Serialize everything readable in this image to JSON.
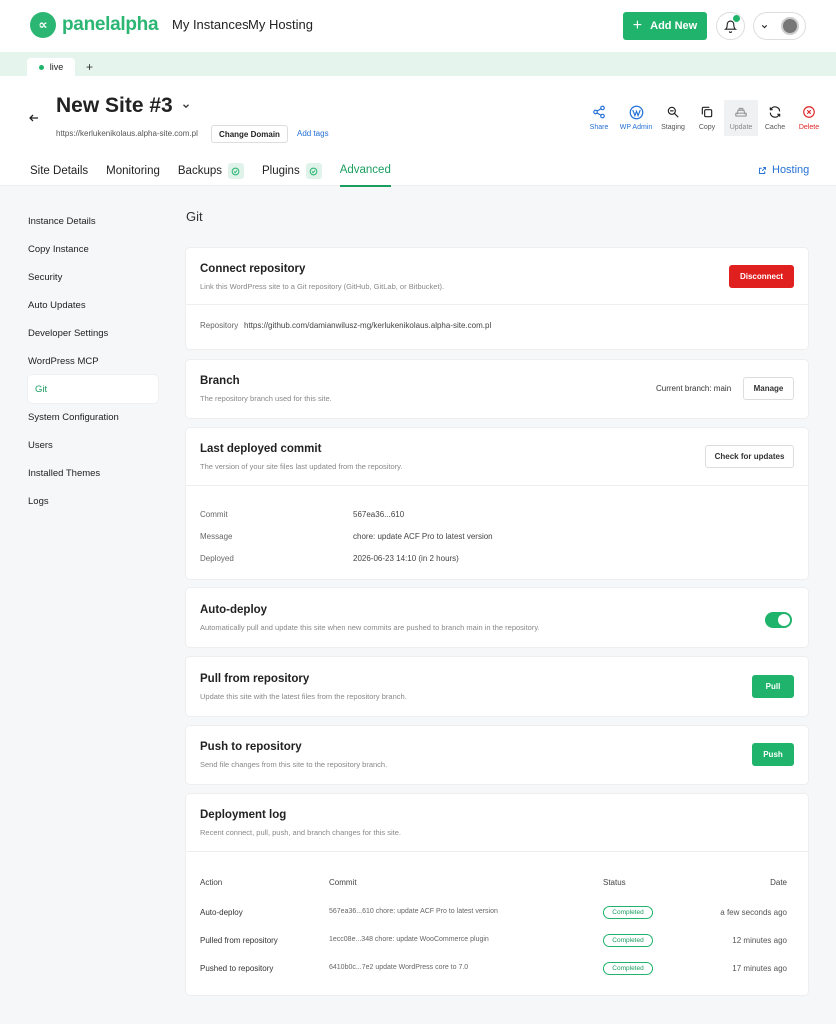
{
  "brand": {
    "logo_text": "panelalpha",
    "logo_mark": "∝",
    "accent": "#1fb36b"
  },
  "topnav": {
    "links": [
      "My Instances",
      "My Hosting"
    ],
    "add_new_label": "Add New"
  },
  "tabs": {
    "live_label": "live",
    "add_label": "+"
  },
  "site": {
    "title": "New Site #3",
    "url": "https://kerlukenikolaus.alpha-site.com.pl",
    "change_domain_label": "Change Domain",
    "add_tags_label": "Add tags",
    "actions": [
      {
        "label": "Share",
        "icon": "share-icon"
      },
      {
        "label": "WP Admin",
        "icon": "wordpress-icon"
      },
      {
        "label": "Staging",
        "icon": "staging-icon"
      },
      {
        "label": "Copy",
        "icon": "copy-icon"
      },
      {
        "label": "Update",
        "icon": "update-icon"
      },
      {
        "label": "Cache",
        "icon": "cache-icon"
      },
      {
        "label": "Delete",
        "icon": "delete-icon"
      }
    ]
  },
  "subtabs": {
    "site_details": "Site Details",
    "monitoring": "Monitoring",
    "backups": "Backups",
    "plugins": "Plugins",
    "advanced": "Advanced",
    "hosting": "Hosting"
  },
  "sidebar": {
    "items": [
      "Instance Details",
      "Copy Instance",
      "Security",
      "Auto Updates",
      "Developer Settings",
      "WordPress MCP",
      "Git",
      "System Configuration",
      "Users",
      "Installed Themes",
      "Logs"
    ],
    "active_index": 6
  },
  "main": {
    "title": "Git",
    "connect": {
      "title": "Connect repository",
      "desc": "Link this WordPress site to a Git repository (GitHub, GitLab, or Bitbucket).",
      "button": "Disconnect",
      "repo_label": "Repository",
      "repo_value": "https://github.com/damianwilusz-mg/kerlukenikolaus.alpha-site.com.pl"
    },
    "branch": {
      "title": "Branch",
      "desc": "The repository branch used for this site.",
      "current": "Current branch: main",
      "button": "Manage"
    },
    "commit": {
      "title": "Last deployed commit",
      "desc": "The version of your site files last updated from the repository.",
      "button": "Check for updates",
      "commit_label": "Commit",
      "commit_value": "567ea36...610",
      "message_label": "Message",
      "message_value": "chore: update ACF Pro to latest version",
      "deployed_label": "Deployed",
      "deployed_value": "2026-06-23 14:10 (in 2 hours)"
    },
    "autodeploy": {
      "title": "Auto-deploy",
      "desc": "Automatically pull and update this site when new commits are pushed to branch main in the repository.",
      "enabled": true
    },
    "pull": {
      "title": "Pull from repository",
      "desc": "Update this site with the latest files from the repository branch.",
      "button": "Pull"
    },
    "push": {
      "title": "Push to repository",
      "desc": "Send file changes from this site to the repository branch.",
      "button": "Push"
    },
    "log": {
      "title": "Deployment log",
      "desc": "Recent connect, pull, push, and branch changes for this site.",
      "headers": {
        "action": "Action",
        "commit": "Commit",
        "status": "Status",
        "date": "Date"
      },
      "rows": [
        {
          "action": "Auto-deploy",
          "commit": "567ea36...610  chore: update ACF Pro to latest version",
          "status": "Completed",
          "date": "a few seconds ago"
        },
        {
          "action": "Pulled from repository",
          "commit": "1ecc08e...348  chore: update WooCommerce plugin",
          "status": "Completed",
          "date": "12 minutes ago"
        },
        {
          "action": "Pushed to repository",
          "commit": "6410b0c...7e2  update WordPress core to 7.0",
          "status": "Completed",
          "date": "17 minutes ago"
        }
      ]
    }
  }
}
